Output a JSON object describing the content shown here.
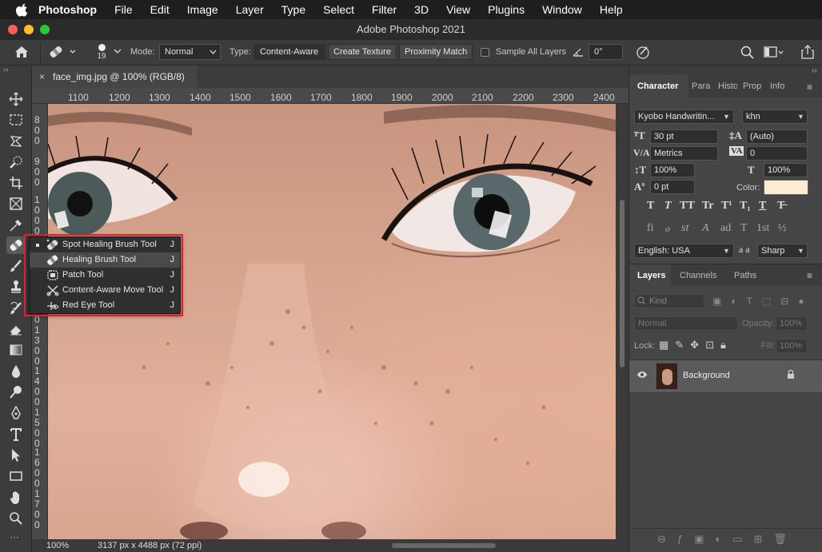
{
  "menubar": {
    "app": "Photoshop",
    "items": [
      "File",
      "Edit",
      "Image",
      "Layer",
      "Type",
      "Select",
      "Filter",
      "3D",
      "View",
      "Plugins",
      "Window",
      "Help"
    ]
  },
  "window": {
    "title": "Adobe Photoshop 2021"
  },
  "options": {
    "brush_size": "19",
    "mode_label": "Mode:",
    "mode_value": "Normal",
    "type_label": "Type:",
    "type_buttons": [
      "Content-Aware",
      "Create Texture",
      "Proximity Match"
    ],
    "sample_all_layers": "Sample All Layers",
    "angle": "0°"
  },
  "document": {
    "tab_title": "face_img.jpg @ 100% (RGB/8)",
    "close": "×",
    "ruler_h": [
      "1100",
      "1200",
      "1300",
      "1400",
      "1500",
      "1600",
      "1700",
      "1800",
      "1900",
      "2000",
      "2100",
      "2200",
      "2300",
      "2400"
    ],
    "ruler_v": [
      "800",
      "900",
      "1000",
      "1100",
      "1200",
      "1300",
      "1400",
      "1500",
      "1600",
      "1700",
      "1800"
    ],
    "zoom": "100%",
    "doc_info": "3137 px x 4488 px (72 ppi)"
  },
  "flyout": {
    "items": [
      {
        "label": "Spot Healing Brush Tool",
        "key": "J",
        "icon": "spot-healing-icon"
      },
      {
        "label": "Healing Brush Tool",
        "key": "J",
        "icon": "healing-brush-icon"
      },
      {
        "label": "Patch Tool",
        "key": "J",
        "icon": "patch-icon"
      },
      {
        "label": "Content-Aware Move Tool",
        "key": "J",
        "icon": "content-aware-move-icon"
      },
      {
        "label": "Red Eye Tool",
        "key": "J",
        "icon": "red-eye-icon"
      }
    ]
  },
  "character": {
    "tabs": [
      "Character",
      "Para",
      "Histo",
      "Prop",
      "Info"
    ],
    "font_family": "Kyobo Handwritin...",
    "font_style": "khn",
    "size": "30 pt",
    "leading": "(Auto)",
    "kerning": "Metrics",
    "tracking": "0",
    "vscale": "100%",
    "hscale": "100%",
    "baseline": "0 pt",
    "color_label": "Color:",
    "color": "#fdebd3",
    "language": "English: USA",
    "aa_label": "a a",
    "antialias": "Sharp",
    "style_glyphs": [
      "T",
      "T",
      "TT",
      "Tr",
      "T¹",
      "T₁",
      "T",
      "T̶"
    ],
    "ot_glyphs": [
      "fi",
      "ℴ",
      "st",
      "A",
      "ad",
      "T",
      "1st",
      "½"
    ]
  },
  "layers": {
    "tabs": [
      "Layers",
      "Channels",
      "Paths"
    ],
    "filter_kind": "Kind",
    "blend_mode": "Normal",
    "opacity_label": "Opacity:",
    "opacity": "100%",
    "lock_label": "Lock:",
    "fill_label": "Fill:",
    "fill": "100%",
    "layer_name": "Background"
  },
  "colors": {
    "highlight_border": "#e0202a",
    "menubar_bg": "#1e1e1e",
    "panel_bg": "#3c3c3c"
  }
}
